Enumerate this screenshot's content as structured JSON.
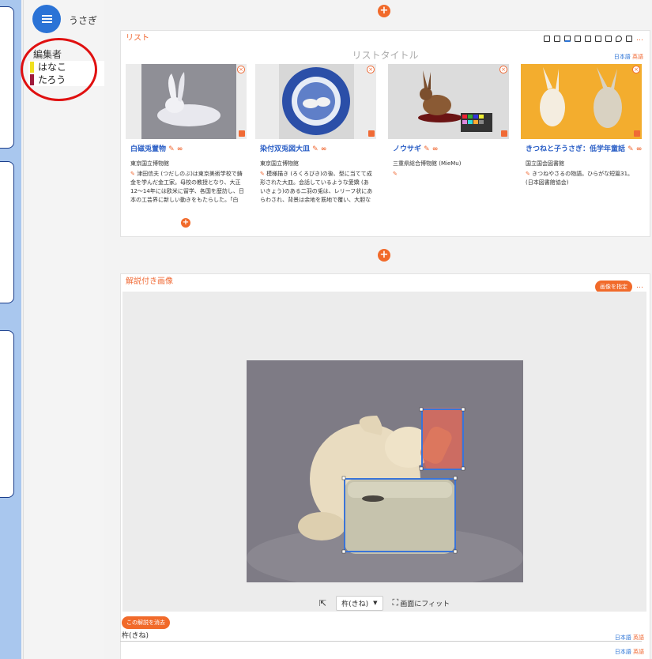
{
  "sidebar": {
    "username": "うさぎ",
    "editors_title": "編集者",
    "editors": [
      {
        "name": "はなこ",
        "color": "#f0e020"
      },
      {
        "name": "たろう",
        "color": "#a01c3c"
      }
    ]
  },
  "list_section": {
    "label": "リスト",
    "title_placeholder": "リストタイトル",
    "lang_primary": "日本語",
    "lang_secondary": "英語",
    "more": "…",
    "cards": [
      {
        "title": "白磁兎置物",
        "source": "東京国立博物館",
        "description": "津田信夫 (つだしのぶ)は東京美術学校で鋳金を学んだ金工家。母校の教授となり、大正12〜14年には欧米に留学、各国を歴訪し、日本の工芸界に新しい動きをもたらした。「白"
      },
      {
        "title": "染付双兎図大皿",
        "source": "東京国立博物館",
        "description": "模様描き (ろくろびき)の後、型に当てて成形された大皿。会話しているような愛嬌 (あいきょう)のある二羽の兎は、レリーフ状にあらわされ、背景は余地を筋地で覆い、大胆な"
      },
      {
        "title": "ノウサギ",
        "source": "三重県総合博物館 (MieMu)",
        "description": ""
      },
      {
        "title": "きつねと子うさぎ：低学年童話",
        "source": "国立国会図書館",
        "description": "きつねやさるの物語。ひらがな短篇31。(日本図書館協会)"
      }
    ]
  },
  "annotated_section": {
    "label": "解説付き画像",
    "set_image_button": "画像を指定",
    "more": "…",
    "select_value": "杵(きね)",
    "fit_label": "画面にフィット",
    "remove_button": "この解説を消去",
    "annotation_name": "杵(きね)",
    "lang_primary": "日本語",
    "lang_secondary": "英語"
  },
  "colors": {
    "accent": "#f16a2a",
    "link": "#2b5fc6",
    "menu": "#2b73d6",
    "annotation_highlight": "#e01010"
  }
}
